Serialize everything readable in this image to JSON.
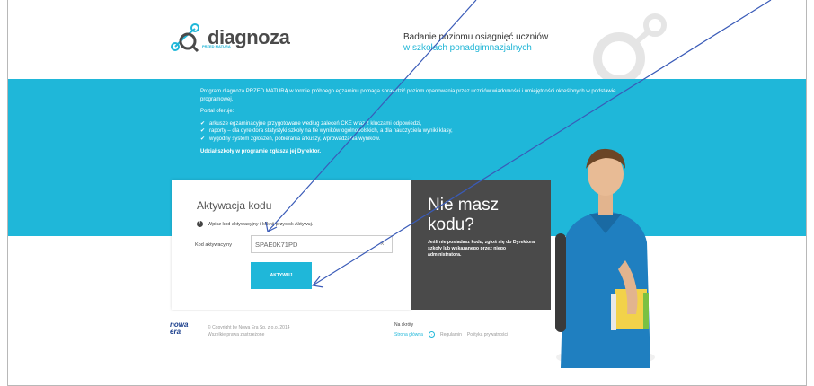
{
  "header": {
    "logo_text": "diagnoza",
    "logo_sub": "PRZED MATURĄ",
    "tagline_line1": "Badanie poziomu osiągnięć uczniów",
    "tagline_line2": "w szkołach ponadgimnazjalnych"
  },
  "intro": {
    "paragraph1": "Program diagnoza PRZED MATURĄ w formie próbnego egzaminu pomaga sprawdzić poziom opanowania przez uczniów wiadomości i umiejętności określonych w podstawie programowej.",
    "offers_label": "Portal oferuje:",
    "offers": [
      "arkusze egzaminacyjne przygotowane według zaleceń CKE wraz z kluczami odpowiedzi,",
      "raporty – dla dyrektora statystyki szkoły na tle wyników ogólnopolskich, a dla nauczyciela wyniki klasy,",
      "wygodny system zgłoszeń, pobierania arkuszy, wprowadzania wyników."
    ],
    "note": "Udział szkoły w programie zgłasza jej Dyrektor."
  },
  "activation": {
    "title": "Aktywacja kodu",
    "info": "Wpisz kod aktywacyjny i kliknij przycisk Aktywuj.",
    "code_label": "Kod aktywacyjny",
    "code_value": "SPAE0K71PD",
    "clear_symbol": "×",
    "button_label": "AKTYWUJ"
  },
  "no_code": {
    "title_line1": "Nie masz",
    "title_line2": "kodu?",
    "text": "Jeśli nie posiadasz kodu, zgłoś się do Dyrektora szkoły lub wskazanego przez niego administratora."
  },
  "footer": {
    "publisher_logo": "nowa era",
    "copyright": "© Copyright by Nowa Era Sp. z o.o. 2014",
    "rights": "Wszelkie prawa zastrzeżone",
    "shortcuts_label": "Na skróty",
    "links": [
      "Strona główna",
      "Regulamin",
      "Polityka prywatności"
    ]
  },
  "colors": {
    "accent": "#1fb7d9",
    "dark_panel": "#4a4a4a",
    "arrow": "#3a5bb8"
  }
}
